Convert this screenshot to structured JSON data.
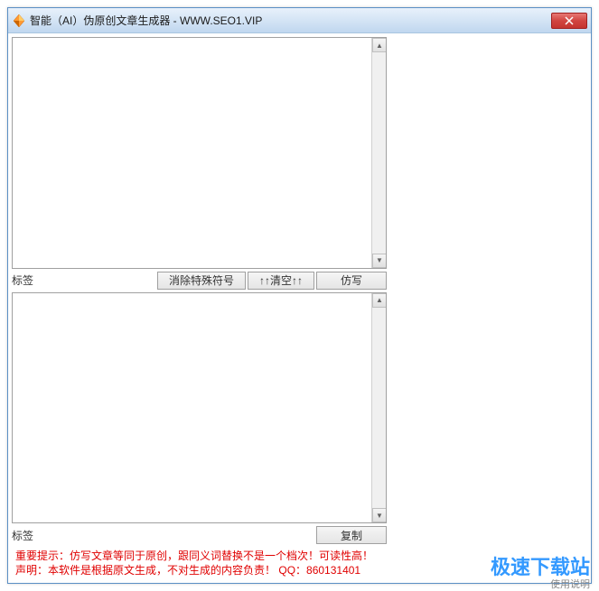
{
  "window": {
    "title": "智能（AI）伪原创文章生成器 - WWW.SEO1.VIP"
  },
  "input_area": {
    "value": ""
  },
  "output_area": {
    "value": ""
  },
  "toolbar_top": {
    "label": "标签",
    "btn_clear_special": "消除特殊符号",
    "btn_clear_all": "↑↑清空↑↑",
    "btn_rewrite": "仿写"
  },
  "toolbar_bottom": {
    "label": "标签",
    "btn_copy": "复制"
  },
  "notice": {
    "line1": "重要提示：仿写文章等同于原创，跟同义词替换不是一个档次！可读性高！",
    "line2_prefix": "声明：本软件是根据原文生成，不对生成的内容负责！",
    "qq_label": "QQ：",
    "qq_number": "860131401"
  },
  "watermark": "极速下载站",
  "usage_link": "使用说明"
}
